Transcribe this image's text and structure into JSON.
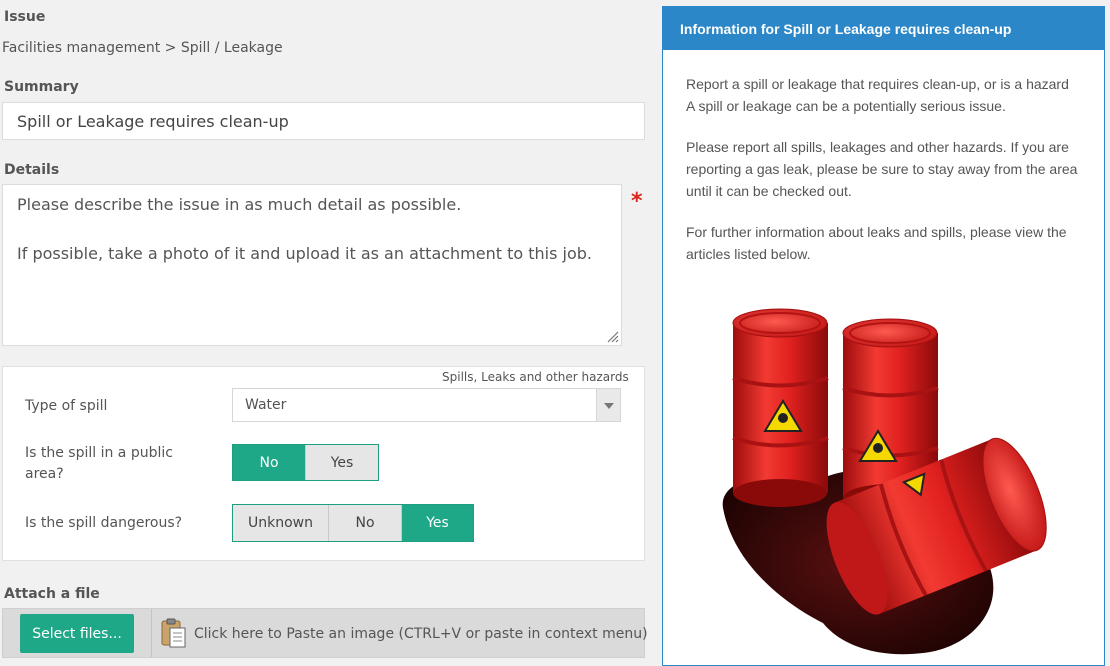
{
  "issue": {
    "label": "Issue",
    "path": "Facilities management > Spill / Leakage"
  },
  "summary": {
    "label": "Summary",
    "value": "Spill or Leakage requires clean-up"
  },
  "details": {
    "label": "Details",
    "line1": "Please describe the issue in as much detail as possible.",
    "line2": "If possible, take a photo of it and upload it as an attachment to this job.",
    "required_mark": "*"
  },
  "custom_fields": {
    "category_tag": "Spills, Leaks and other hazards",
    "type_of_spill": {
      "label": "Type of spill",
      "value": "Water"
    },
    "public_area": {
      "label": "Is the spill in a public area?",
      "options": [
        "No",
        "Yes"
      ],
      "selected": "No"
    },
    "dangerous": {
      "label": "Is the spill dangerous?",
      "options": [
        "Unknown",
        "No",
        "Yes"
      ],
      "selected": "Yes"
    }
  },
  "attach": {
    "label": "Attach a file",
    "select_button": "Select files...",
    "paste_text": "Click here to Paste an image (CTRL+V or paste in context menu)"
  },
  "info": {
    "title": "Information for Spill or Leakage requires clean-up",
    "p1a": "Report a spill or leakage that requires clean-up, or is a hazard",
    "p1b": "A spill or leakage can be a potentially serious issue.",
    "p2": "Please report all spills, leakages and other hazards. If you are reporting a gas leak, please be sure to stay away from the area until it can be checked out.",
    "p3": "For further information about leaks and spills, please view the articles listed below."
  },
  "colors": {
    "accent_green": "#1ea887",
    "header_blue": "#2b87c8",
    "required_red": "#d9241c",
    "barrel_red": "#e0211f"
  }
}
